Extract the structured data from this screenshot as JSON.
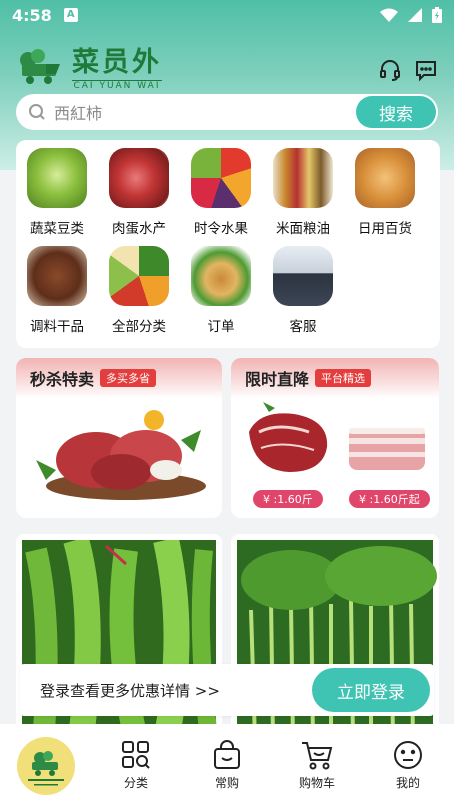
{
  "status": {
    "time": "4:58"
  },
  "brand": {
    "name": "菜员外",
    "name_en": "CAI YUAN WAI"
  },
  "search": {
    "placeholder": "西紅柿",
    "button": "搜索"
  },
  "categories": [
    {
      "label": "蔬菜豆类",
      "icon": "cabbage-image"
    },
    {
      "label": "肉蛋水产",
      "icon": "meat-image"
    },
    {
      "label": "时令水果",
      "icon": "fruit-image"
    },
    {
      "label": "米面粮油",
      "icon": "grain-oil-image"
    },
    {
      "label": "日用百货",
      "icon": "bread-image"
    },
    {
      "label": "调料干品",
      "icon": "spice-image"
    },
    {
      "label": "全部分类",
      "icon": "all-category-image"
    },
    {
      "label": "订单",
      "icon": "order-basket-image"
    },
    {
      "label": "客服",
      "icon": "customer-service-image"
    }
  ],
  "promo_flash": {
    "title": "秒杀特卖",
    "tag": "多买多省"
  },
  "promo_drop": {
    "title": "限时直降",
    "tag": "平台精选",
    "price1": "¥ :1.60斤",
    "price2": "¥ :1.60斤起"
  },
  "login": {
    "prompt": "登录查看更多优惠详情 >>",
    "button": "立即登录"
  },
  "tabs": [
    {
      "label": "",
      "icon": "home-logo-icon"
    },
    {
      "label": "分类",
      "icon": "category-icon"
    },
    {
      "label": "常购",
      "icon": "bag-icon"
    },
    {
      "label": "购物车",
      "icon": "cart-icon"
    },
    {
      "label": "我的",
      "icon": "profile-icon"
    }
  ],
  "colors": {
    "accent": "#3fc4b4",
    "brand": "#1f7a3a",
    "promo_red": "#e33d3d",
    "price_pink": "#e0466a"
  }
}
